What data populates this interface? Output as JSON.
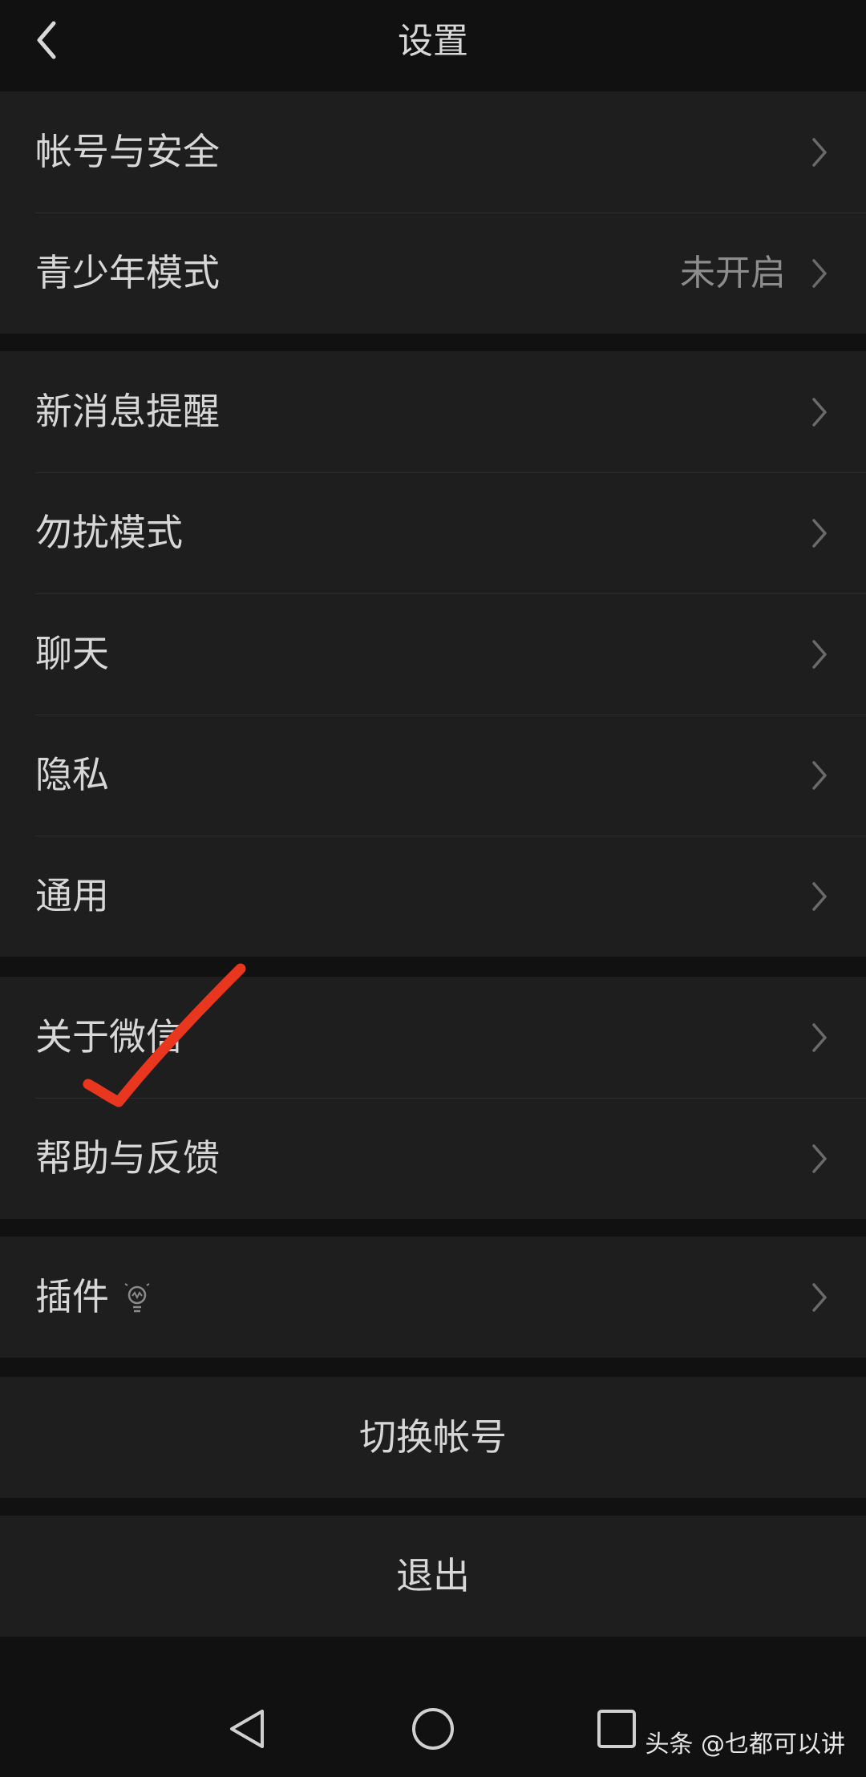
{
  "header": {
    "title": "设置",
    "back_icon": "chevron-left-icon"
  },
  "group_account": [
    {
      "label": "帐号与安全",
      "value": ""
    },
    {
      "label": "青少年模式",
      "value": "未开启"
    }
  ],
  "group_settings": [
    {
      "label": "新消息提醒"
    },
    {
      "label": "勿扰模式"
    },
    {
      "label": "聊天"
    },
    {
      "label": "隐私"
    },
    {
      "label": "通用"
    }
  ],
  "group_about": [
    {
      "label": "关于微信"
    },
    {
      "label": "帮助与反馈"
    }
  ],
  "group_plugins": [
    {
      "label": "插件",
      "icon": "lightbulb-icon"
    }
  ],
  "actions": {
    "switch_account": "切换帐号",
    "logout": "退出"
  },
  "annotation": {
    "mark": "checkmark",
    "color": "#e8361f"
  },
  "system_nav": {
    "back_icon": "triangle-back-icon",
    "home_icon": "circle-home-icon",
    "recents_icon": "square-recents-icon"
  },
  "watermark": "头条 @乜都可以讲",
  "colors": {
    "background": "#111111",
    "row_background": "#1e1e1e",
    "text": "#d7d7d7",
    "secondary_text": "#8d8d8d"
  }
}
